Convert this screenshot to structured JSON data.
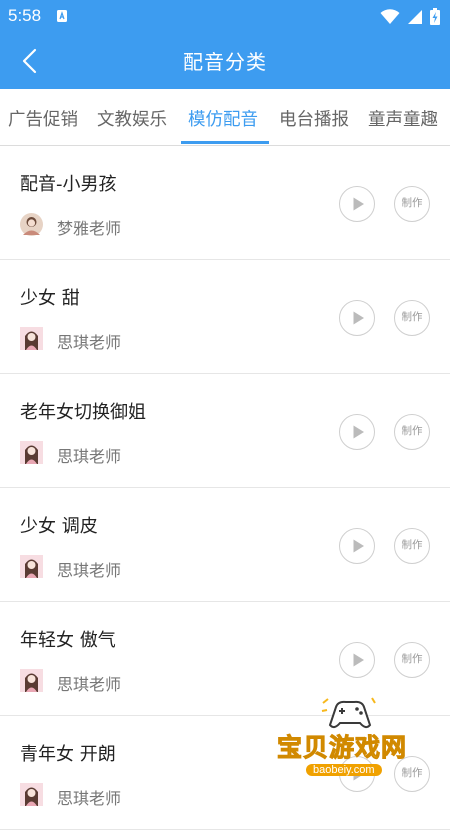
{
  "status_bar": {
    "time": "5:58",
    "icons": [
      "sim-card-icon",
      "wifi-icon",
      "cellular-signal-icon",
      "battery-charging-icon"
    ]
  },
  "header": {
    "title": "配音分类",
    "back_icon": "chevron-left-icon",
    "background_color": "#3d9cf0"
  },
  "tabs": [
    {
      "label": "广告促销",
      "active": false
    },
    {
      "label": "文教娱乐",
      "active": false
    },
    {
      "label": "模仿配音",
      "active": true
    },
    {
      "label": "电台播报",
      "active": false
    },
    {
      "label": "童声童趣",
      "active": false
    }
  ],
  "accent_color": "#3d9cf0",
  "items": [
    {
      "title": "配音-小男孩",
      "teacher": "梦雅老师",
      "play_icon": "play-icon",
      "make_label": "制作"
    },
    {
      "title": "少女 甜",
      "teacher": "思琪老师",
      "play_icon": "play-icon",
      "make_label": "制作"
    },
    {
      "title": "老年女切换御姐",
      "teacher": "思琪老师",
      "play_icon": "play-icon",
      "make_label": "制作"
    },
    {
      "title": "少女 调皮",
      "teacher": "思琪老师",
      "play_icon": "play-icon",
      "make_label": "制作"
    },
    {
      "title": "年轻女 傲气",
      "teacher": "思琪老师",
      "play_icon": "play-icon",
      "make_label": "制作"
    },
    {
      "title": "青年女 开朗",
      "teacher": "思琪老师",
      "play_icon": "play-icon",
      "make_label": "制作"
    }
  ],
  "watermark": {
    "text": "宝贝游戏网",
    "url_text": "baobeiy.com"
  }
}
